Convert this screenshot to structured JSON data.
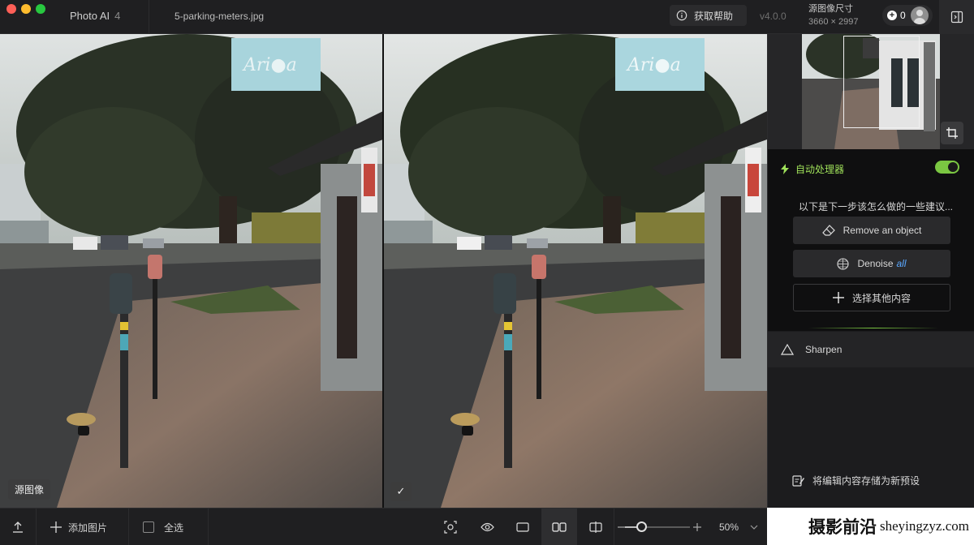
{
  "window": {
    "app_name": "Photo AI",
    "app_version_badge": "4",
    "file_name": "5-parking-meters.jpg",
    "help_label": "获取帮助",
    "version": "v4.0.0",
    "source_size_label": "源图像尺寸",
    "source_size_value": "3660 × 2997",
    "credits": "0"
  },
  "preview": {
    "left_label": "源图像",
    "right_badge": "✓",
    "sign_text": "Ari●a"
  },
  "side_panel": {
    "autopilot_label": "自动处理器",
    "autopilot_enabled": true,
    "suggestion_text": "以下是下一步该怎么做的一些建议...",
    "actions": [
      {
        "label": "Remove an object",
        "suffix": ""
      },
      {
        "label": "Denoise",
        "suffix": "all"
      },
      {
        "label": "选择其他内容",
        "suffix": ""
      }
    ],
    "sharpen_label": "Sharpen",
    "save_preset_label": "将编辑内容存储为新预设"
  },
  "bottom_bar": {
    "add_images_label": "添加图片",
    "select_all_label": "全选",
    "zoom_label": "50%",
    "zoom_level": 0.25
  },
  "watermark": {
    "cn": "摄影前沿",
    "en": "sheyingzyz.com"
  },
  "colors": {
    "accent_green": "#7bc742",
    "link_blue": "#5aa8ff",
    "panel_bg": "#1c1c1e"
  }
}
